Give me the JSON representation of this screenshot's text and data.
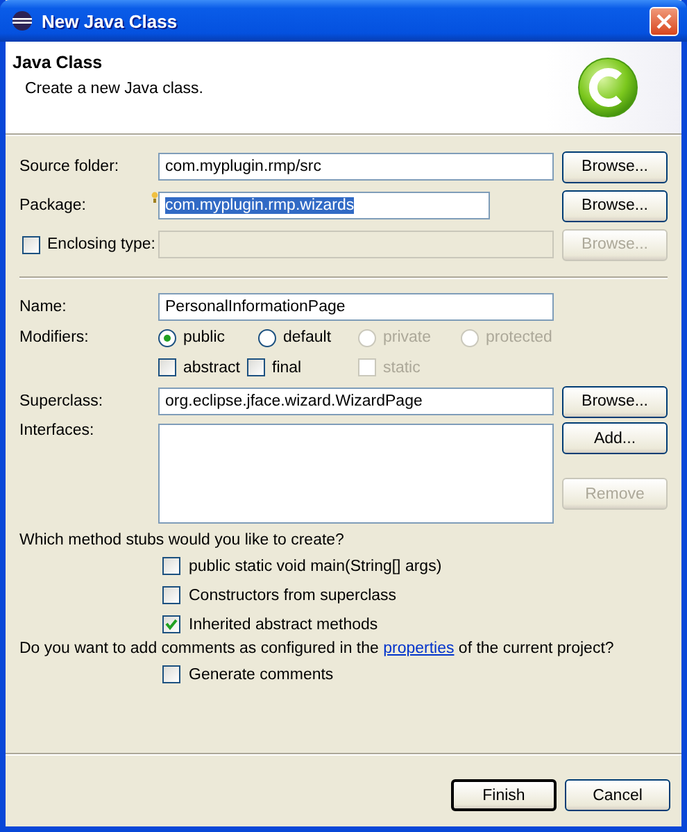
{
  "window": {
    "title": "New Java Class"
  },
  "header": {
    "title": "Java Class",
    "description": "Create a new Java class."
  },
  "source_folder": {
    "label": "Source folder:",
    "value": "com.myplugin.rmp/src",
    "browse": {
      "label": "Browse...",
      "disabled": false
    }
  },
  "package": {
    "label": "Package:",
    "value": "com.myplugin.rmp.wizards",
    "value_selected": true,
    "hint": true,
    "browse": {
      "label": "Browse...",
      "disabled": false
    }
  },
  "enclosing_type": {
    "label": "Enclosing type:",
    "checked": false,
    "disabled": true,
    "browse": {
      "label": "Browse...",
      "disabled": true
    }
  },
  "name": {
    "label": "Name:",
    "value": "PersonalInformationPage"
  },
  "modifiers": {
    "label": "Modifiers:",
    "access": [
      {
        "label": "public",
        "selected": true,
        "disabled": false
      },
      {
        "label": "default",
        "selected": false,
        "disabled": false
      },
      {
        "label": "private",
        "selected": false,
        "disabled": true
      },
      {
        "label": "protected",
        "selected": false,
        "disabled": true
      }
    ],
    "flags": [
      {
        "label": "abstract",
        "checked": false,
        "disabled": false
      },
      {
        "label": "final",
        "checked": false,
        "disabled": false
      },
      {
        "label": "static",
        "checked": false,
        "disabled": true
      }
    ]
  },
  "superclass": {
    "label": "Superclass:",
    "value": "org.eclipse.jface.wizard.WizardPage",
    "browse": {
      "label": "Browse...",
      "disabled": false
    }
  },
  "interfaces": {
    "label": "Interfaces:",
    "buttons": [
      {
        "label": "Add...",
        "disabled": false
      },
      {
        "label": "Remove",
        "disabled": true
      }
    ]
  },
  "method_stubs": {
    "question": "Which method stubs would you like to create?",
    "options": [
      {
        "label": "public static void main(String[] args)",
        "checked": false
      },
      {
        "label": "Constructors from superclass",
        "checked": false
      },
      {
        "label": "Inherited abstract methods",
        "checked": true
      }
    ]
  },
  "comments": {
    "before": "Do you want to add comments as configured in the ",
    "link": "properties",
    "after": " of the current project?",
    "options": [
      {
        "label": "Generate comments",
        "checked": false
      }
    ]
  },
  "buttons": [
    {
      "label": "Finish",
      "default": true
    },
    {
      "label": "Cancel",
      "default": false
    }
  ]
}
